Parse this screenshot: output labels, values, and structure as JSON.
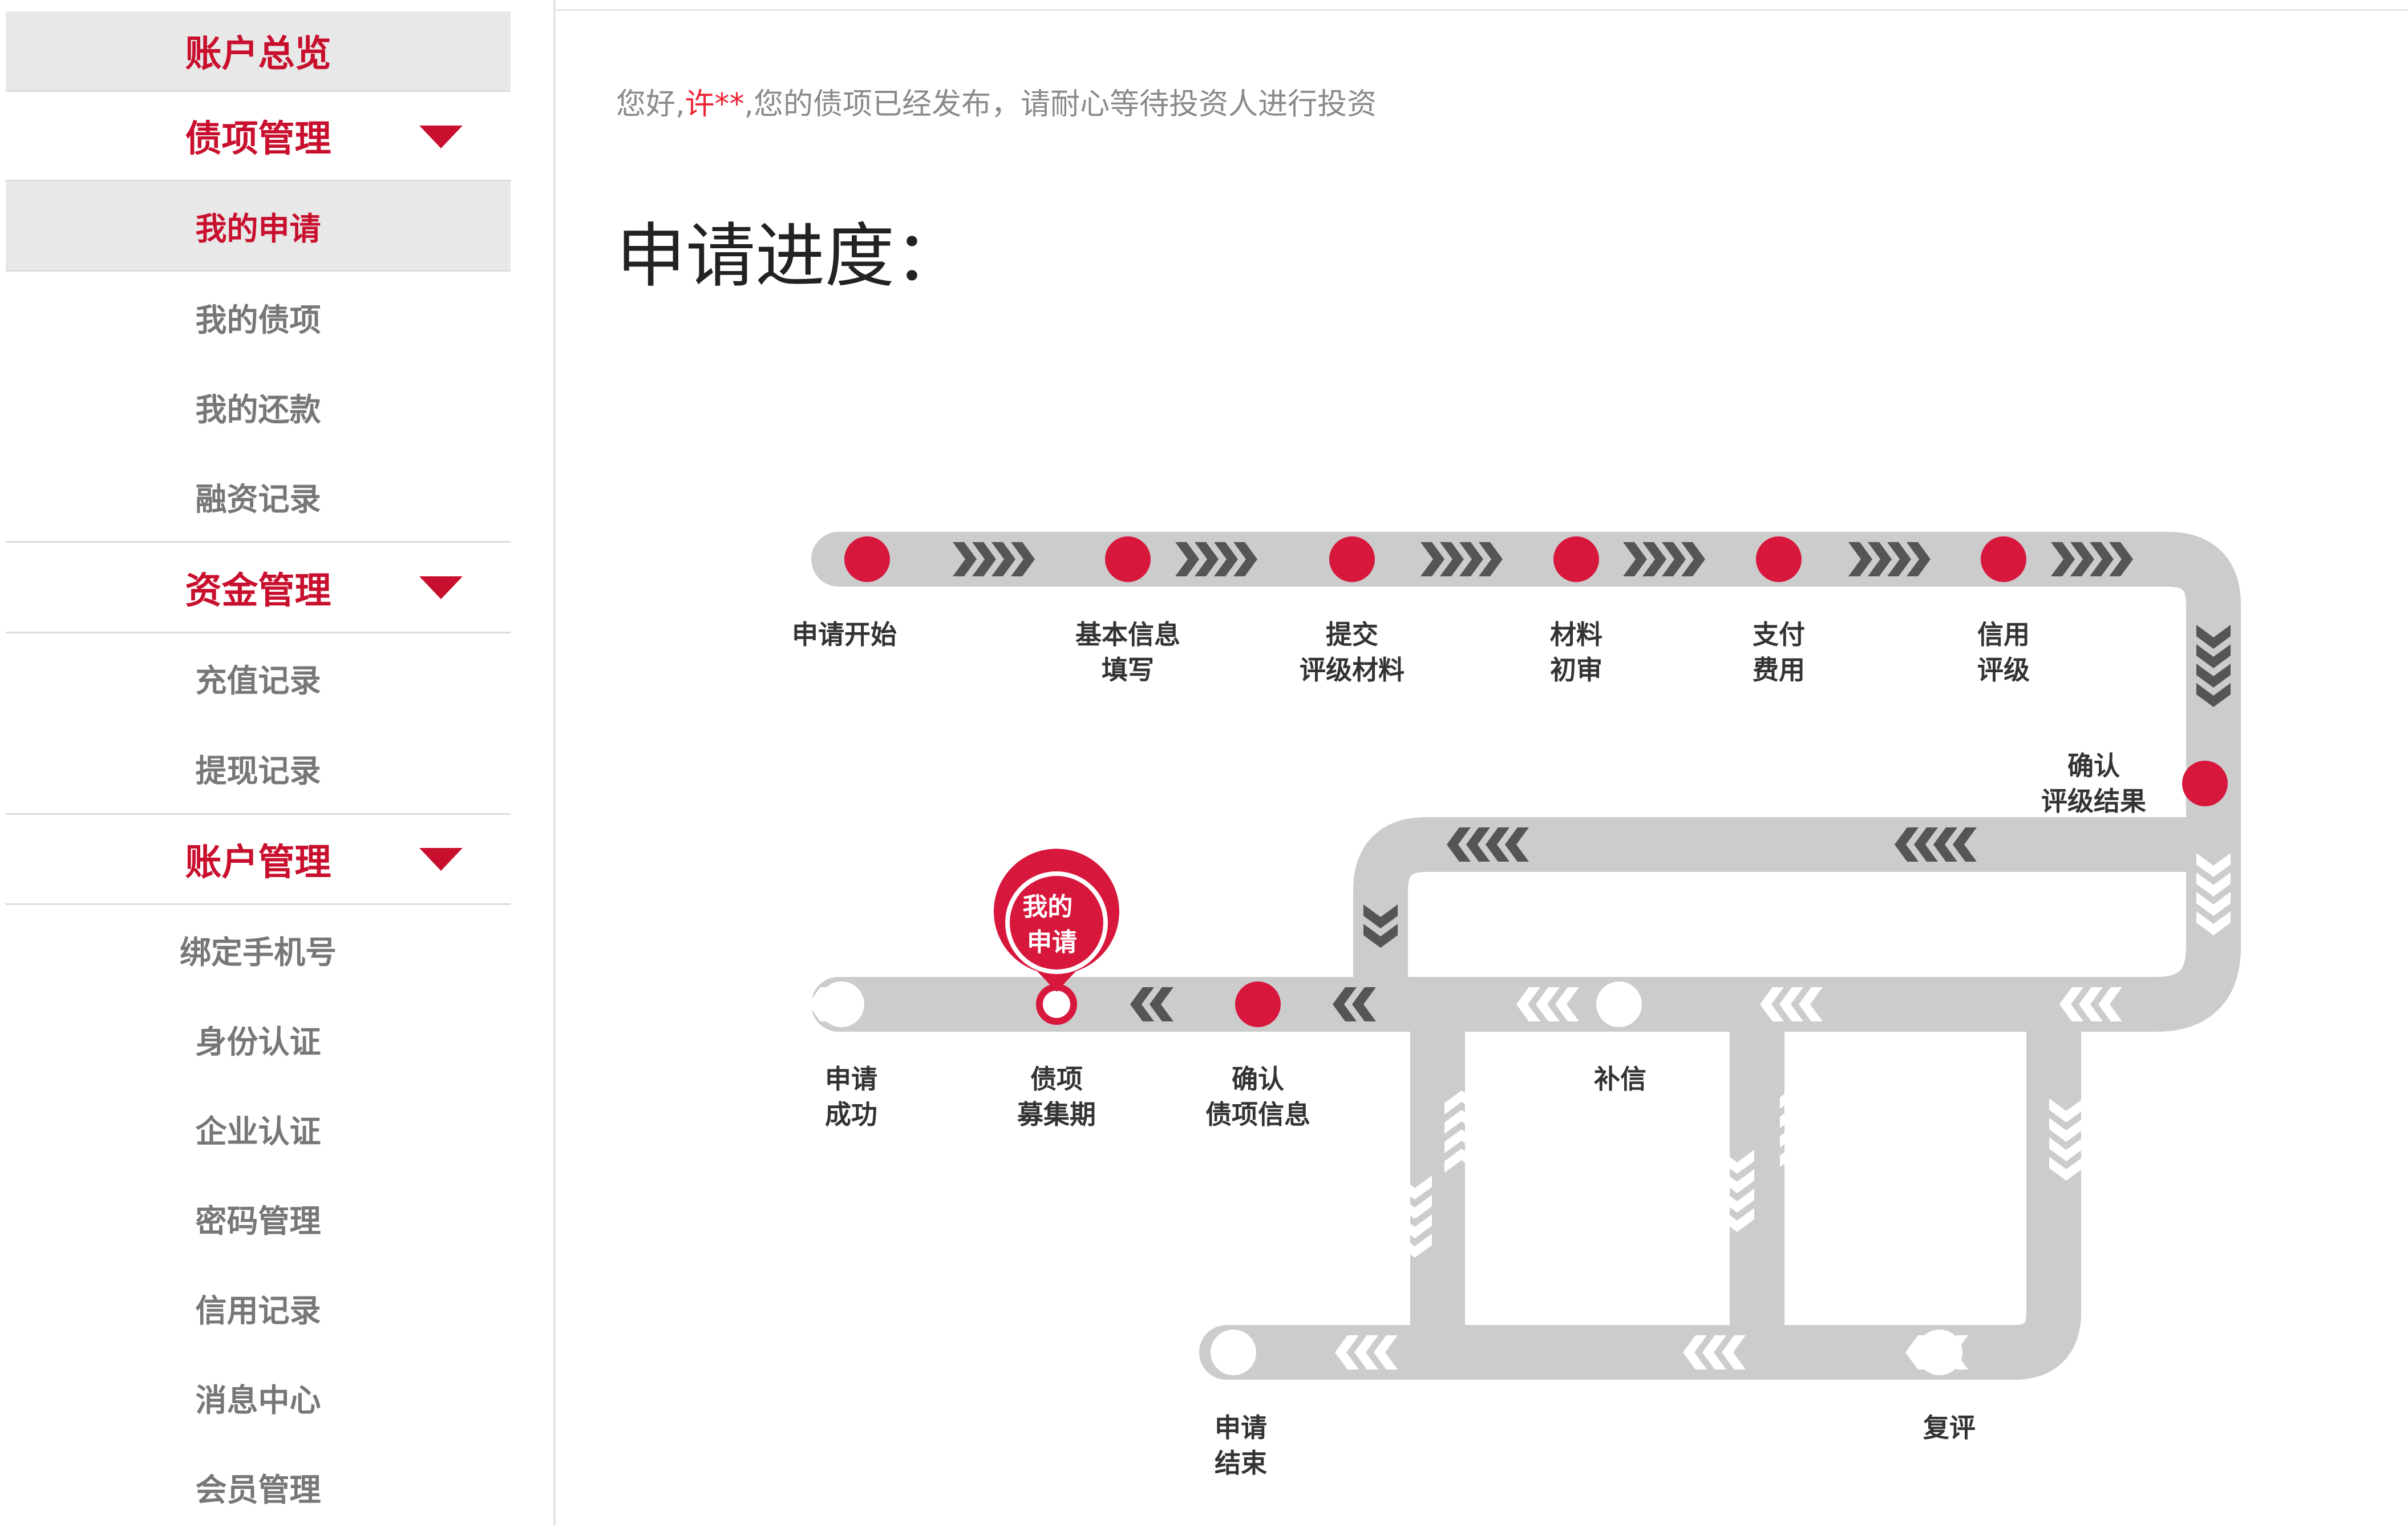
{
  "sidebar": {
    "overview": "账户总览",
    "sections": [
      {
        "title": "债项管理",
        "items": [
          "我的申请",
          "我的债项",
          "我的还款",
          "融资记录"
        ]
      },
      {
        "title": "资金管理",
        "items": [
          "充值记录",
          "提现记录"
        ]
      },
      {
        "title": "账户管理",
        "items": [
          "绑定手机号",
          "身份认证",
          "企业认证",
          "密码管理",
          "信用记录",
          "消息中心",
          "会员管理"
        ]
      }
    ],
    "active_item": "我的申请"
  },
  "greeting": {
    "prefix": "您好,",
    "name": "许**",
    "suffix": ",您的债项已经发布，请耐心等待投资人进行投资"
  },
  "progress_title": "申请进度：",
  "diagram": {
    "steps": {
      "s1": [
        "申请开始"
      ],
      "s2": [
        "基本信息",
        "填写"
      ],
      "s3": [
        "提交",
        "评级材料"
      ],
      "s4": [
        "材料",
        "初审"
      ],
      "s5": [
        "支付",
        "费用"
      ],
      "s6": [
        "信用",
        "评级"
      ],
      "s7": [
        "确认",
        "评级结果"
      ],
      "s8": [
        "确认",
        "债项信息"
      ],
      "s9": [
        "债项",
        "募集期"
      ],
      "s10": [
        "申请",
        "成功"
      ],
      "s11": [
        "补信"
      ],
      "s12": [
        "申请",
        "结束"
      ],
      "s13": [
        "复评"
      ]
    },
    "marker": [
      "我的",
      "申请"
    ],
    "colors": {
      "track": "#cccccc",
      "done": "#d8173d",
      "arrow": "#555555",
      "arrow_light": "#ffffff"
    }
  }
}
